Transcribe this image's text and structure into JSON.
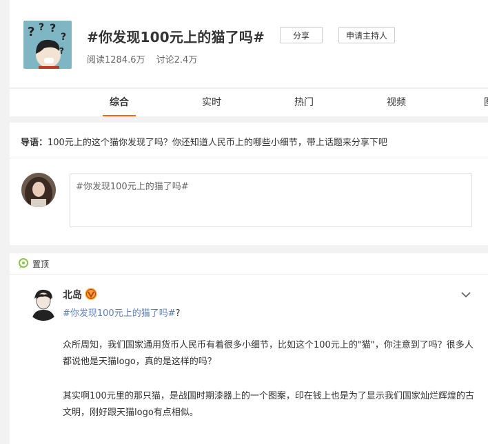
{
  "topic": {
    "title": "#你发现100元上的猫了吗#",
    "reads": "阅读1284.6万",
    "discussions": "讨论2.4万",
    "share_label": "分享",
    "apply_host_label": "申请主持人"
  },
  "tabs": [
    {
      "label": "综合",
      "active": true
    },
    {
      "label": "实时"
    },
    {
      "label": "热门"
    },
    {
      "label": "视频"
    },
    {
      "label": "图"
    }
  ],
  "guide": {
    "label": "导语：",
    "text": "100元上的这个猫你发现了吗？你还知道人民币上的哪些小细节，带上话题来分享下吧"
  },
  "composer": {
    "value": "#你发现100元上的猫了吗#"
  },
  "feed": {
    "pinned_label": "置顶",
    "post": {
      "author": "北岛",
      "tag": "#你发现100元上的猫了吗#",
      "tag_suffix": "?",
      "paragraphs": [
        "众所周知，我们国家通用货币人民币有着很多小细节，比如这个100元上的\"猫\"，你注意到了吗？很多人都说他是天猫logo，真的是这样的吗？",
        "其实啊100元里的那只猫，是战国时期漆器上的一个图案，印在钱上也是为了显示我们国家灿烂辉煌的古文明，刚好跟天猫logo有点相似。"
      ]
    }
  },
  "colors": {
    "accent": "#ff6600",
    "link": "#5d7fb8",
    "cover_bg": "#7fb6c4",
    "vip_badge": "#f5a623"
  },
  "icons": [
    "question-cover-image",
    "pin-icon",
    "vip-badge-icon",
    "chevron-down-icon"
  ]
}
